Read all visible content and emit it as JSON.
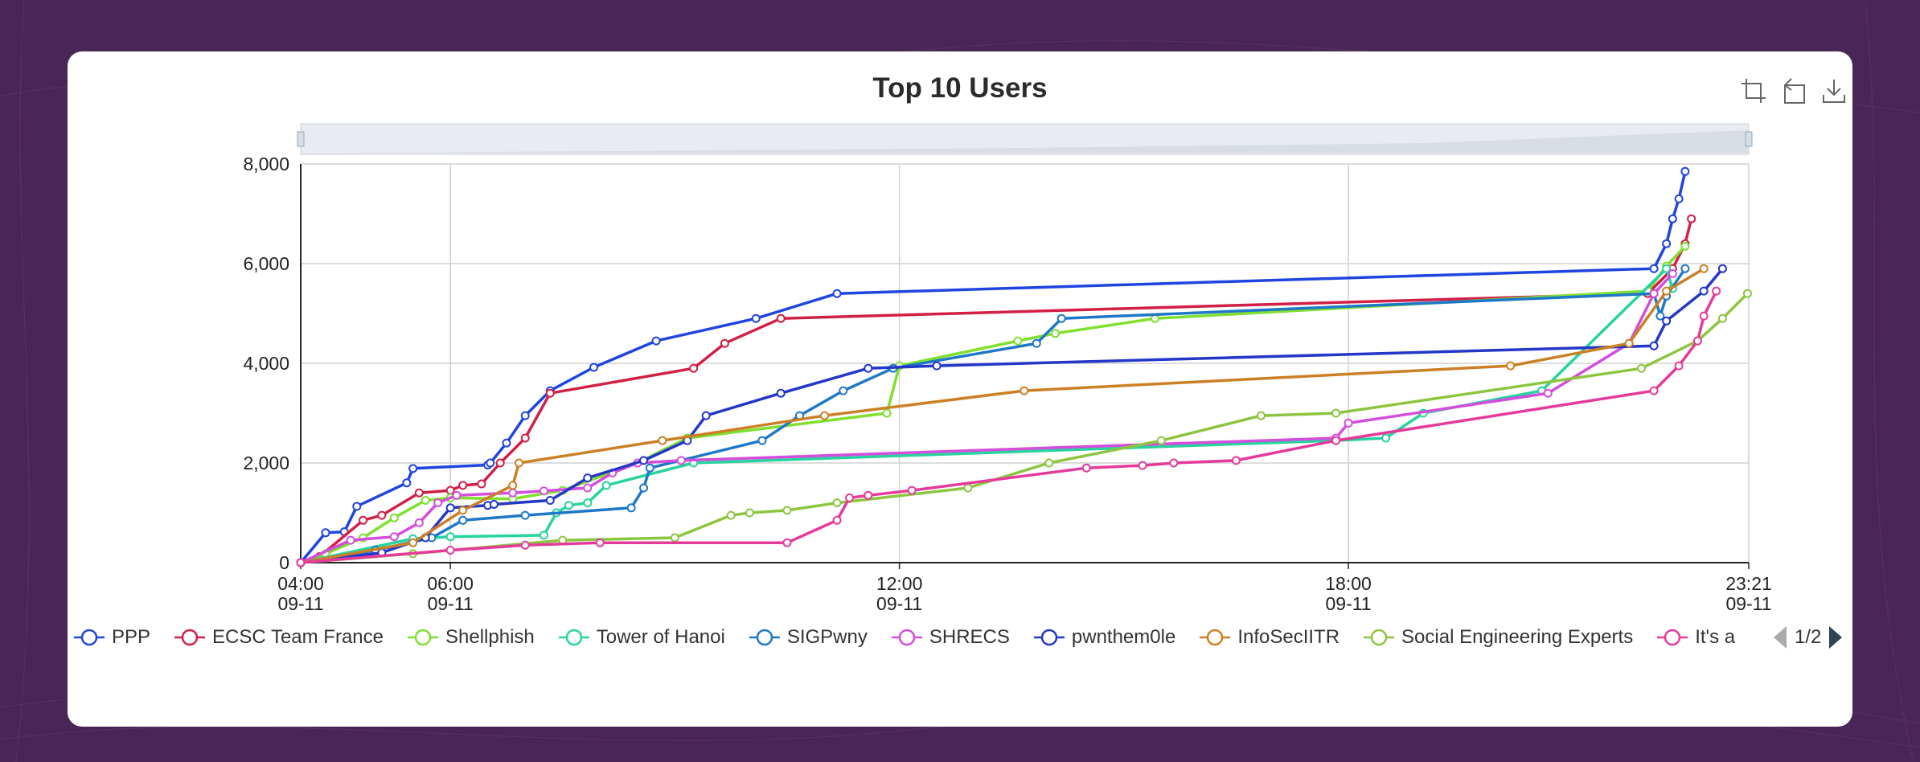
{
  "page": {
    "background": "#4a2558",
    "card_background": "#ffffff"
  },
  "toolbox": {
    "icons": [
      "data-zoom-icon",
      "zoom-reset-icon",
      "save-as-image-icon"
    ]
  },
  "legend_pager": {
    "text": "1/2"
  },
  "chart_data": {
    "type": "line",
    "title": "Top 10 Users",
    "xlabel": "",
    "ylabel": "",
    "x_type": "time",
    "xlim": [
      "2024-09-11T04:00",
      "2024-09-11T23:21"
    ],
    "ylim": [
      0,
      8000
    ],
    "yticks": [
      "0",
      "2,000",
      "4,000",
      "6,000",
      "8,000"
    ],
    "xticks": [
      {
        "x": "2024-09-11T04:00",
        "label": [
          "04:00",
          "09-11"
        ]
      },
      {
        "x": "2024-09-11T06:00",
        "label": [
          "06:00",
          "09-11"
        ]
      },
      {
        "x": "2024-09-11T12:00",
        "label": [
          "12:00",
          "09-11"
        ]
      },
      {
        "x": "2024-09-11T18:00",
        "label": [
          "18:00",
          "09-11"
        ]
      },
      {
        "x": "2024-09-11T23:21",
        "label": [
          "23:21",
          "09-11"
        ]
      }
    ],
    "grid": true,
    "legend_position": "bottom",
    "data_zoom_slider": true,
    "series": [
      {
        "name": "PPP",
        "legend": "PPP",
        "color": "#1f45e0",
        "points": [
          [
            "04:00",
            0
          ],
          [
            "04:20",
            600
          ],
          [
            "04:35",
            620
          ],
          [
            "04:45",
            1130
          ],
          [
            "05:25",
            1600
          ],
          [
            "05:30",
            1890
          ],
          [
            "06:30",
            1960
          ],
          [
            "06:32",
            2000
          ],
          [
            "06:45",
            2400
          ],
          [
            "07:00",
            2950
          ],
          [
            "07:20",
            3450
          ],
          [
            "07:55",
            3920
          ],
          [
            "08:45",
            4450
          ],
          [
            "10:05",
            4900
          ],
          [
            "11:10",
            5400
          ],
          [
            "22:05",
            5900
          ],
          [
            "22:15",
            6400
          ],
          [
            "22:20",
            6900
          ],
          [
            "22:25",
            7300
          ],
          [
            "22:30",
            7850
          ]
        ]
      },
      {
        "name": "ECSC Team France",
        "legend": "ECSC Team France",
        "color": "#d11f46",
        "points": [
          [
            "04:00",
            0
          ],
          [
            "04:15",
            120
          ],
          [
            "04:50",
            850
          ],
          [
            "05:05",
            950
          ],
          [
            "05:35",
            1400
          ],
          [
            "06:00",
            1450
          ],
          [
            "06:10",
            1550
          ],
          [
            "06:25",
            1580
          ],
          [
            "06:40",
            2000
          ],
          [
            "07:00",
            2500
          ],
          [
            "07:20",
            3400
          ],
          [
            "09:15",
            3900
          ],
          [
            "09:40",
            4400
          ],
          [
            "10:25",
            4900
          ],
          [
            "22:00",
            5400
          ],
          [
            "22:20",
            5900
          ],
          [
            "22:30",
            6400
          ],
          [
            "22:35",
            6900
          ]
        ]
      },
      {
        "name": "Shellphish",
        "legend": "Shellphish",
        "color": "#7fe02e",
        "points": [
          [
            "04:00",
            0
          ],
          [
            "04:20",
            180
          ],
          [
            "04:50",
            500
          ],
          [
            "05:15",
            900
          ],
          [
            "05:40",
            1250
          ],
          [
            "06:00",
            1300
          ],
          [
            "06:50",
            1280
          ],
          [
            "07:30",
            1450
          ],
          [
            "08:30",
            2000
          ],
          [
            "09:10",
            2500
          ],
          [
            "11:50",
            3000
          ],
          [
            "12:00",
            3950
          ],
          [
            "13:35",
            4450
          ],
          [
            "14:05",
            4600
          ],
          [
            "15:25",
            4900
          ],
          [
            "22:00",
            5450
          ],
          [
            "22:15",
            5950
          ],
          [
            "22:30",
            6350
          ]
        ]
      },
      {
        "name": "Tower of Hanoi",
        "legend": "Tower of Hanoi",
        "color": "#27d39e",
        "points": [
          [
            "04:00",
            0
          ],
          [
            "05:30",
            480
          ],
          [
            "06:00",
            520
          ],
          [
            "07:15",
            550
          ],
          [
            "07:25",
            1000
          ],
          [
            "07:35",
            1150
          ],
          [
            "07:50",
            1200
          ],
          [
            "08:05",
            1550
          ],
          [
            "09:15",
            2000
          ],
          [
            "17:50",
            2450
          ],
          [
            "18:30",
            2500
          ],
          [
            "19:00",
            3000
          ],
          [
            "20:35",
            3450
          ],
          [
            "22:15",
            5900
          ],
          [
            "22:20",
            5500
          ]
        ]
      },
      {
        "name": "SIGPwny",
        "legend": "SIGPwny",
        "color": "#1e78c8",
        "points": [
          [
            "04:00",
            0
          ],
          [
            "05:00",
            250
          ],
          [
            "05:45",
            500
          ],
          [
            "06:10",
            850
          ],
          [
            "07:00",
            950
          ],
          [
            "08:25",
            1100
          ],
          [
            "08:35",
            1500
          ],
          [
            "08:40",
            1900
          ],
          [
            "10:10",
            2450
          ],
          [
            "10:40",
            2950
          ],
          [
            "11:15",
            3450
          ],
          [
            "11:55",
            3900
          ],
          [
            "13:50",
            4400
          ],
          [
            "14:10",
            4900
          ],
          [
            "22:05",
            5400
          ],
          [
            "22:10",
            4950
          ],
          [
            "22:15",
            5350
          ],
          [
            "22:30",
            5900
          ]
        ]
      },
      {
        "name": "SHRECS",
        "legend": "SHRECS",
        "color": "#d44ddc",
        "points": [
          [
            "04:00",
            0
          ],
          [
            "04:40",
            450
          ],
          [
            "05:15",
            520
          ],
          [
            "05:35",
            800
          ],
          [
            "05:50",
            1200
          ],
          [
            "06:05",
            1350
          ],
          [
            "06:50",
            1400
          ],
          [
            "07:15",
            1440
          ],
          [
            "07:50",
            1500
          ],
          [
            "08:10",
            1800
          ],
          [
            "08:30",
            2000
          ],
          [
            "09:05",
            2050
          ],
          [
            "17:50",
            2500
          ],
          [
            "18:00",
            2800
          ],
          [
            "20:40",
            3400
          ],
          [
            "21:45",
            4400
          ],
          [
            "22:05",
            5400
          ],
          [
            "22:20",
            5800
          ]
        ]
      },
      {
        "name": "pwnthem0le",
        "legend": "pwnthem0le",
        "color": "#2337c8",
        "points": [
          [
            "04:00",
            0
          ],
          [
            "05:05",
            200
          ],
          [
            "05:40",
            500
          ],
          [
            "06:00",
            1100
          ],
          [
            "06:30",
            1150
          ],
          [
            "06:35",
            1170
          ],
          [
            "07:20",
            1250
          ],
          [
            "07:50",
            1700
          ],
          [
            "08:35",
            2050
          ],
          [
            "09:10",
            2450
          ],
          [
            "09:25",
            2950
          ],
          [
            "10:25",
            3400
          ],
          [
            "11:35",
            3900
          ],
          [
            "12:30",
            3950
          ],
          [
            "22:05",
            4350
          ],
          [
            "22:15",
            4850
          ],
          [
            "22:45",
            5450
          ],
          [
            "23:00",
            5900
          ]
        ]
      },
      {
        "name": "InfoSecIITR",
        "legend": "InfoSecIITR",
        "color": "#cc8025",
        "points": [
          [
            "04:00",
            0
          ],
          [
            "05:30",
            400
          ],
          [
            "06:10",
            1050
          ],
          [
            "06:50",
            1550
          ],
          [
            "06:55",
            2000
          ],
          [
            "08:50",
            2450
          ],
          [
            "11:00",
            2950
          ],
          [
            "13:40",
            3450
          ],
          [
            "20:10",
            3950
          ],
          [
            "21:45",
            4400
          ],
          [
            "22:15",
            5450
          ],
          [
            "22:45",
            5900
          ]
        ]
      },
      {
        "name": "Social Engineering Experts",
        "legend": "Social Engineering Experts",
        "color": "#8cc63f",
        "points": [
          [
            "04:00",
            0
          ],
          [
            "05:30",
            180
          ],
          [
            "07:30",
            450
          ],
          [
            "09:00",
            500
          ],
          [
            "09:45",
            950
          ],
          [
            "10:00",
            1000
          ],
          [
            "10:30",
            1050
          ],
          [
            "11:10",
            1200
          ],
          [
            "12:55",
            1500
          ],
          [
            "14:00",
            2000
          ],
          [
            "15:30",
            2450
          ],
          [
            "16:50",
            2950
          ],
          [
            "17:50",
            3000
          ],
          [
            "21:55",
            3900
          ],
          [
            "22:40",
            4450
          ],
          [
            "23:00",
            4900
          ],
          [
            "23:20",
            5400
          ]
        ]
      },
      {
        "name": "It's a",
        "legend": "It's a",
        "color": "#e53a9b",
        "points": [
          [
            "04:00",
            0
          ],
          [
            "06:00",
            250
          ],
          [
            "07:00",
            350
          ],
          [
            "08:00",
            400
          ],
          [
            "10:30",
            400
          ],
          [
            "11:10",
            850
          ],
          [
            "11:20",
            1300
          ],
          [
            "11:35",
            1350
          ],
          [
            "12:10",
            1450
          ],
          [
            "14:30",
            1900
          ],
          [
            "15:15",
            1950
          ],
          [
            "15:40",
            2000
          ],
          [
            "16:30",
            2050
          ],
          [
            "17:50",
            2450
          ],
          [
            "22:05",
            3450
          ],
          [
            "22:25",
            3950
          ],
          [
            "22:40",
            4450
          ],
          [
            "22:45",
            4950
          ],
          [
            "22:55",
            5450
          ]
        ]
      }
    ]
  }
}
